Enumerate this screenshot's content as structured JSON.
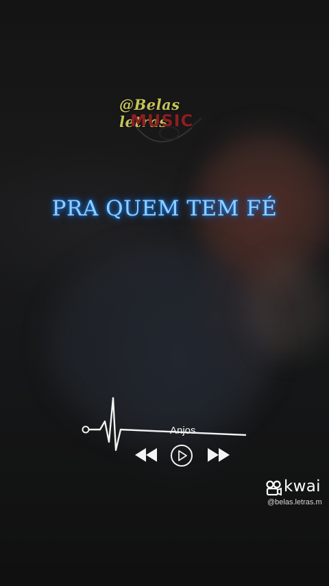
{
  "watermark_logo": {
    "line1": "@Belas letras",
    "line2": "MUSIC",
    "icon": "guitar-emblem-icon"
  },
  "lyric": {
    "text": "PRA QUEM TEM FÉ",
    "color": "#8fd0ff",
    "glow_color": "#1e7fe6"
  },
  "player": {
    "track_title": "Anjos",
    "icons": {
      "pulse": "heartbeat-line-icon",
      "rewind": "rewind-icon",
      "play": "play-circle-icon",
      "fast_forward": "fast-forward-icon"
    }
  },
  "kwai_watermark": {
    "brand": "kwai",
    "handle": "@belas.letras.m",
    "icon": "kwai-logo-icon"
  }
}
